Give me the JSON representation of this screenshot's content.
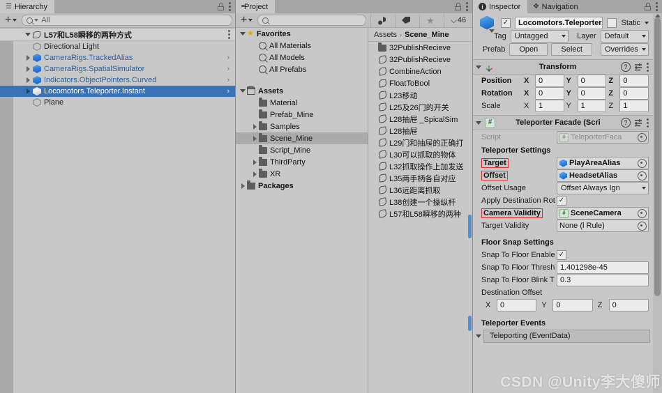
{
  "hierarchy": {
    "tab_label": "Hierarchy",
    "tab_icon": "hierarchy-icon",
    "toolbar": {
      "add_label": "+",
      "search_value": "All"
    },
    "scene": {
      "name": "L57和L58瞬移的两种方式"
    },
    "items": [
      {
        "label": "Directional Light",
        "icon": "gameobject-icon",
        "kind": "plain",
        "expandable": false,
        "selected": false,
        "chevron": false
      },
      {
        "label": "CameraRigs.TrackedAlias",
        "icon": "prefab-icon",
        "kind": "prefab",
        "expandable": true,
        "selected": false,
        "chevron": true
      },
      {
        "label": "CameraRigs.SpatialSimulator",
        "icon": "prefab-icon",
        "kind": "prefab",
        "expandable": true,
        "selected": false,
        "chevron": true
      },
      {
        "label": "Indicators.ObjectPointers.Curved",
        "icon": "prefab-icon",
        "kind": "prefab",
        "expandable": true,
        "selected": false,
        "chevron": true
      },
      {
        "label": "Locomotors.Teleporter.Instant",
        "icon": "prefab-icon",
        "kind": "prefab",
        "expandable": true,
        "selected": true,
        "chevron": true
      },
      {
        "label": "Plane",
        "icon": "gameobject-icon",
        "kind": "plain",
        "expandable": false,
        "selected": false,
        "chevron": false
      }
    ]
  },
  "project": {
    "tab_label": "Project",
    "tab_icon": "folder-icon",
    "toolbar": {
      "add_label": "+",
      "search_value": "",
      "icon_buttons": [
        "asset-filter-icon",
        "label-filter-icon",
        "favorite-star-icon"
      ],
      "hidden_count_icon": "hidden-packages-icon",
      "hidden_count": "46"
    },
    "tree": [
      {
        "label": "Favorites",
        "depth": 0,
        "icon": "star-icon",
        "bold": true,
        "twirl": "down",
        "selected": false
      },
      {
        "label": "All Materials",
        "depth": 1,
        "icon": "search-icon",
        "bold": false,
        "twirl": "none",
        "selected": false
      },
      {
        "label": "All Models",
        "depth": 1,
        "icon": "search-icon",
        "bold": false,
        "twirl": "none",
        "selected": false
      },
      {
        "label": "All Prefabs",
        "depth": 1,
        "icon": "search-icon",
        "bold": false,
        "twirl": "none",
        "selected": false
      },
      {
        "label": "",
        "depth": 0,
        "icon": "none",
        "bold": false,
        "twirl": "none",
        "selected": false
      },
      {
        "label": "Assets",
        "depth": 0,
        "icon": "folder-open-icon",
        "bold": true,
        "twirl": "down",
        "selected": false
      },
      {
        "label": "Material",
        "depth": 1,
        "icon": "folder-icon",
        "bold": false,
        "twirl": "none",
        "selected": false
      },
      {
        "label": "Prefab_Mine",
        "depth": 1,
        "icon": "folder-icon",
        "bold": false,
        "twirl": "none",
        "selected": false
      },
      {
        "label": "Samples",
        "depth": 1,
        "icon": "folder-icon",
        "bold": false,
        "twirl": "right",
        "selected": false
      },
      {
        "label": "Scene_Mine",
        "depth": 1,
        "icon": "folder-icon",
        "bold": false,
        "twirl": "right",
        "selected": true
      },
      {
        "label": "Script_Mine",
        "depth": 1,
        "icon": "folder-icon",
        "bold": false,
        "twirl": "none",
        "selected": false
      },
      {
        "label": "ThirdParty",
        "depth": 1,
        "icon": "folder-icon",
        "bold": false,
        "twirl": "right",
        "selected": false
      },
      {
        "label": "XR",
        "depth": 1,
        "icon": "folder-icon",
        "bold": false,
        "twirl": "right",
        "selected": false
      },
      {
        "label": "Packages",
        "depth": 0,
        "icon": "folder-icon",
        "bold": true,
        "twirl": "right",
        "selected": false
      }
    ],
    "breadcrumb": {
      "root": "Assets",
      "separator": "›",
      "current": "Scene_Mine"
    },
    "files": [
      {
        "label": "32PublishRecieve",
        "icon": "folder-icon"
      },
      {
        "label": "32PublishRecieve",
        "icon": "scene-icon"
      },
      {
        "label": "CombineAction",
        "icon": "scene-icon"
      },
      {
        "label": "FloatToBool",
        "icon": "scene-icon"
      },
      {
        "label": "L23移动",
        "icon": "scene-icon"
      },
      {
        "label": "L25及26门的开关",
        "icon": "scene-icon"
      },
      {
        "label": "L28抽屉 _SpicalSim",
        "icon": "scene-icon"
      },
      {
        "label": "L28抽屉",
        "icon": "scene-icon"
      },
      {
        "label": "L29门和抽屉的正确打",
        "icon": "scene-icon"
      },
      {
        "label": "L30可以抓取的物体",
        "icon": "scene-icon"
      },
      {
        "label": "L32抓取操作上加发送",
        "icon": "scene-icon"
      },
      {
        "label": "L35两手柄各自对应",
        "icon": "scene-icon"
      },
      {
        "label": "L36远距离抓取",
        "icon": "scene-icon"
      },
      {
        "label": "L38创建一个操纵杆",
        "icon": "scene-icon"
      },
      {
        "label": "L57和L58瞬移的两种",
        "icon": "scene-icon"
      }
    ]
  },
  "inspector": {
    "tabs": [
      {
        "label": "Inspector",
        "icon": "info-icon",
        "active": true
      },
      {
        "label": "Navigation",
        "icon": "navigation-icon",
        "active": false
      }
    ],
    "gameobject": {
      "enabled_checkbox": "✓",
      "name": "Locomotors.Teleporter.Instant",
      "static_checkbox": "",
      "static_label": "Static",
      "tag_label": "Tag",
      "tag_value": "Untagged",
      "layer_label": "Layer",
      "layer_value": "Default",
      "prefab_label": "Prefab",
      "prefab_open": "Open",
      "prefab_select": "Select",
      "prefab_overrides": "Overrides"
    },
    "transform": {
      "title": "Transform",
      "icon": "transform-icon",
      "rows": [
        {
          "name": "Position",
          "bold": true,
          "x": "0",
          "y": "0",
          "z": "0"
        },
        {
          "name": "Rotation",
          "bold": true,
          "x": "0",
          "y": "0",
          "z": "0"
        },
        {
          "name": "Scale",
          "bold": false,
          "x": "1",
          "y": "1",
          "z": "1"
        }
      ]
    },
    "teleporter": {
      "title": "Teleporter Facade (Scri",
      "icon": "script-icon",
      "script_label": "Script",
      "script_value": "TeleporterFaca",
      "settings_header": "Teleporter Settings",
      "fields": [
        {
          "name": "Target",
          "highlight": true,
          "type": "object",
          "value": "PlayAreaAlias",
          "value_icon": "prefab-icon"
        },
        {
          "name": "Offset",
          "highlight": true,
          "type": "object",
          "value": "HeadsetAlias",
          "value_icon": "prefab-icon"
        },
        {
          "name": "Offset Usage",
          "highlight": false,
          "type": "dropdown",
          "value": "Offset Always Ign"
        },
        {
          "name": "Apply Destination Rot",
          "highlight": false,
          "type": "checkbox",
          "value": "✓"
        },
        {
          "name": "Camera Validity",
          "highlight": true,
          "type": "object",
          "value": "SceneCamera",
          "value_icon": "script-icon"
        },
        {
          "name": "Target Validity",
          "highlight": false,
          "type": "object",
          "value": "None (l Rule)",
          "value_icon": "none"
        }
      ],
      "floor_header": "Floor Snap Settings",
      "floor_fields": [
        {
          "name": "Snap To Floor Enable",
          "type": "checkbox",
          "value": "✓"
        },
        {
          "name": "Snap To Floor Thresh",
          "type": "text",
          "value": "1.401298e-45"
        },
        {
          "name": "Snap To Floor Blink T",
          "type": "text",
          "value": "0.3"
        }
      ],
      "destination_offset_label": "Destination Offset",
      "destination_offset": {
        "x": "0",
        "y": "0",
        "z": "0"
      },
      "events_header": "Teleporter Events",
      "event_row": "Teleporting (EventData)"
    }
  },
  "watermark": "CSDN @Unity李大傻师",
  "colors": {
    "selection_blue": "#3a72b8",
    "panel_bg": "#c8c8c8",
    "tabbar_bg": "#a5a5a5",
    "highlight_red": "#e03131",
    "prefab_blue": "#2b5f9e",
    "star_gold": "#e2a70f"
  }
}
